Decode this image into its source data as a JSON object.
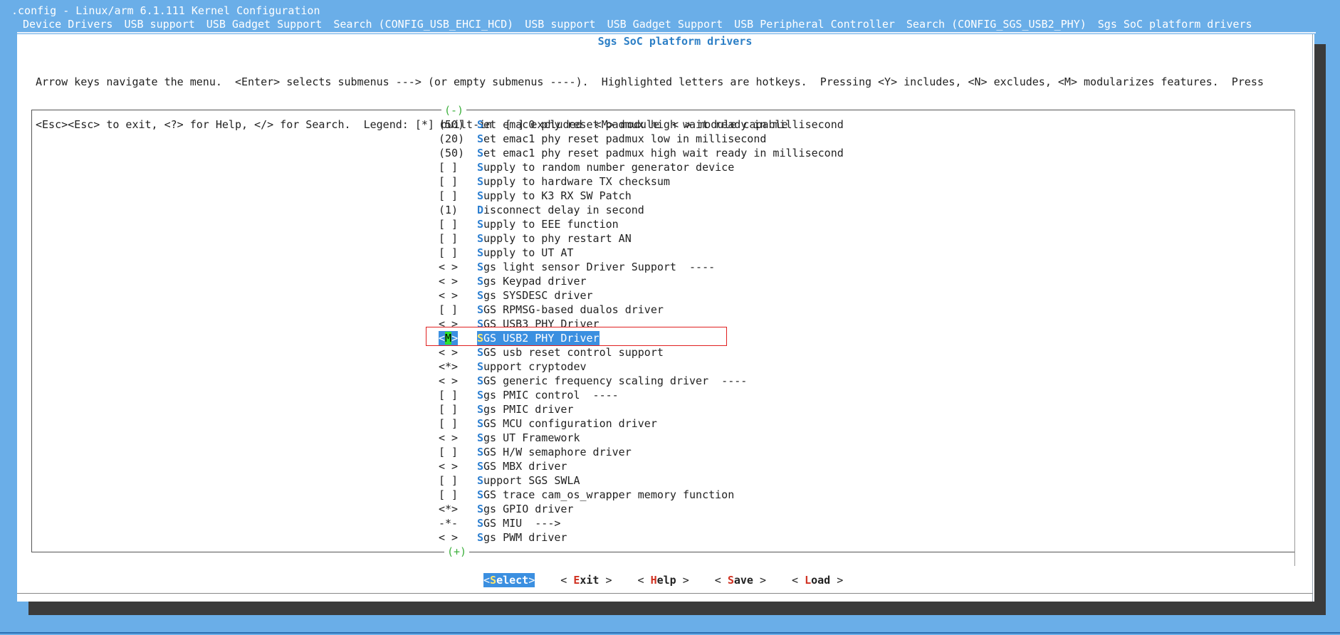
{
  "window": {
    "title": ".config - Linux/arm 6.1.111 Kernel Configuration"
  },
  "breadcrumb": [
    "Device Drivers",
    "USB support",
    "USB Gadget Support",
    "Search (CONFIG_USB_EHCI_HCD)",
    "USB support",
    "USB Gadget Support",
    "USB Peripheral Controller",
    "Search (CONFIG_SGS_USB2_PHY)",
    "Sgs SoC platform drivers"
  ],
  "dialog": {
    "title": "Sgs SoC platform drivers",
    "help_line_1": "Arrow keys navigate the menu.  <Enter> selects submenus ---> (or empty submenus ----).  Highlighted letters are hotkeys.  Pressing <Y> includes, <N> excludes, <M> modularizes features.  Press",
    "help_line_2": "<Esc><Esc> to exit, <?> for Help, </> for Search.  Legend: [*] built-in  [ ] excluded  <M> module  < > module capable",
    "scroll_top": "(-)",
    "scroll_bottom": "(+)"
  },
  "menu": {
    "items": [
      {
        "state": "(50)",
        "hot": "S",
        "rest": "et emac0 phy reset padmux high wait ready in millisecond"
      },
      {
        "state": "(20)",
        "hot": "S",
        "rest": "et emac1 phy reset padmux low in millisecond"
      },
      {
        "state": "(50)",
        "hot": "S",
        "rest": "et emac1 phy reset padmux high wait ready in millisecond"
      },
      {
        "state": "[ ]",
        "hot": "S",
        "rest": "upply to random number generator device"
      },
      {
        "state": "[ ]",
        "hot": "S",
        "rest": "upply to hardware TX checksum"
      },
      {
        "state": "[ ]",
        "hot": "S",
        "rest": "upply to K3 RX SW Patch"
      },
      {
        "state": "(1)",
        "hot": "D",
        "rest": "isconnect delay in second"
      },
      {
        "state": "[ ]",
        "hot": "S",
        "rest": "upply to EEE function"
      },
      {
        "state": "[ ]",
        "hot": "S",
        "rest": "upply to phy restart AN"
      },
      {
        "state": "[ ]",
        "hot": "S",
        "rest": "upply to UT AT"
      },
      {
        "state": "< >",
        "hot": "S",
        "rest": "gs light sensor Driver Support  ----"
      },
      {
        "state": "< >",
        "hot": "S",
        "rest": "gs Keypad driver"
      },
      {
        "state": "< >",
        "hot": "S",
        "rest": "gs SYSDESC driver"
      },
      {
        "state": "[ ]",
        "hot": "S",
        "rest": "GS RPMSG-based dualos driver"
      },
      {
        "state": "< >",
        "hot": "S",
        "rest": "GS USB3 PHY Driver"
      },
      {
        "state_prefix": "<",
        "state_mark": "M",
        "state_suffix": ">",
        "hot": "S",
        "rest": "GS USB2 PHY Driver",
        "selected": true
      },
      {
        "state": "< >",
        "hot": "S",
        "rest": "GS usb reset control support"
      },
      {
        "state": "<*>",
        "hot": "S",
        "rest": "upport cryptodev"
      },
      {
        "state": "< >",
        "hot": "S",
        "rest": "GS generic frequency scaling driver  ----"
      },
      {
        "state": "[ ]",
        "hot": "S",
        "rest": "gs PMIC control  ----"
      },
      {
        "state": "[ ]",
        "hot": "S",
        "rest": "gs PMIC driver"
      },
      {
        "state": "[ ]",
        "hot": "S",
        "rest": "GS MCU configuration driver"
      },
      {
        "state": "< >",
        "hot": "S",
        "rest": "gs UT Framework"
      },
      {
        "state": "[ ]",
        "hot": "S",
        "rest": "GS H/W semaphore driver"
      },
      {
        "state": "< >",
        "hot": "S",
        "rest": "GS MBX driver"
      },
      {
        "state": "[ ]",
        "hot": "S",
        "rest": "upport SGS SWLA"
      },
      {
        "state": "[ ]",
        "hot": "S",
        "rest": "GS trace cam_os_wrapper memory function"
      },
      {
        "state": "<*>",
        "hot": "S",
        "rest": "gs GPIO driver"
      },
      {
        "state": "-*-",
        "hot": "S",
        "rest": "GS MIU  --->"
      },
      {
        "state": "< >",
        "hot": "S",
        "rest": "gs PWM driver"
      }
    ]
  },
  "buttons": {
    "select": {
      "open": "<",
      "hot": "S",
      "rest": "elect",
      "close": ">"
    },
    "exit": {
      "open": "< ",
      "hot": "E",
      "rest": "xit",
      "close": " >"
    },
    "help": {
      "open": "< ",
      "hot": "H",
      "rest": "elp",
      "close": " >"
    },
    "save": {
      "open": "< ",
      "hot": "S",
      "rest": "ave",
      "close": " >"
    },
    "load": {
      "open": "< ",
      "hot": "L",
      "rest": "oad",
      "close": " >"
    }
  }
}
